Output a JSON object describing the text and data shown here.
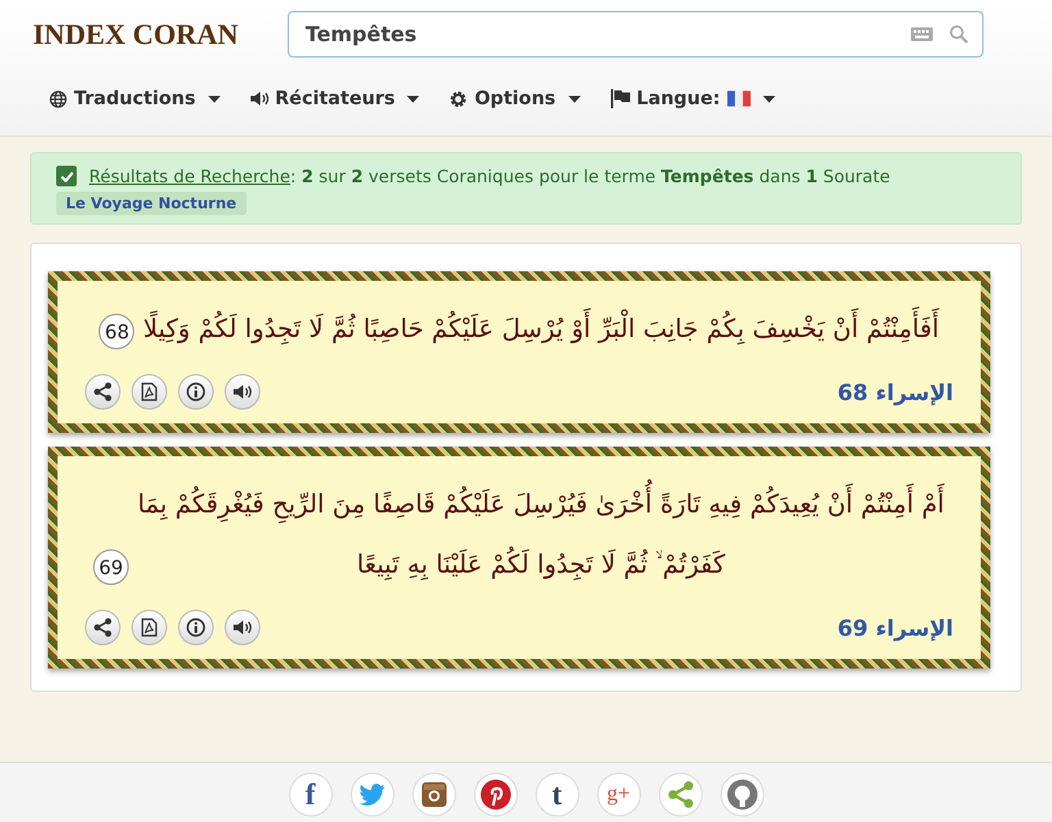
{
  "header": {
    "logo": "INDEX CORAN",
    "search": {
      "value": "Tempêtes"
    }
  },
  "nav": [
    {
      "kind": "globe",
      "label": "Traductions"
    },
    {
      "kind": "speaker",
      "label": "Récitateurs"
    },
    {
      "kind": "gear",
      "label": "Options"
    },
    {
      "kind": "flag",
      "label": "Langue:"
    }
  ],
  "alert": {
    "checked": true,
    "link": "Résultats de Recherche",
    "text": ": **2** sur **2** versets Coraniques pour le terme **Tempêtes** dans **1** Sourate",
    "tag": "Le Voyage Nocturne"
  },
  "verses": [
    {
      "text": "أَفَأَمِنْتُمْ أَنْ يَخْسِفَ بِكُمْ جَانِبَ الْبَرِّ أَوْ يُرْسِلَ عَلَيْكُمْ حَاصِبًا ثُمَّ لَا تَجِدُوا لَكُمْ وَكِيلًا",
      "number": "68",
      "reference": "الإسراء 68"
    },
    {
      "text": "أَمْ أَمِنْتُمْ أَنْ يُعِيدَكُمْ فِيهِ تَارَةً أُخْرَىٰ فَيُرْسِلَ عَلَيْكُمْ قَاصِفًا مِنَ الرِّيحِ فَيُغْرِقَكُمْ بِمَا كَفَرْتُمْ ۙ ثُمَّ لَا تَجِدُوا لَكُمْ عَلَيْنَا بِهِ تَبِيعًا",
      "number": "69",
      "reference": "الإسراء 69"
    }
  ],
  "social": [
    {
      "kind": "facebook",
      "glyph": "f"
    },
    {
      "kind": "twitter"
    },
    {
      "kind": "instagram"
    },
    {
      "kind": "pinterest"
    },
    {
      "kind": "tumblr",
      "glyph": "t"
    },
    {
      "kind": "googleplus",
      "glyph": "g+"
    },
    {
      "kind": "share"
    },
    {
      "kind": "github"
    }
  ]
}
